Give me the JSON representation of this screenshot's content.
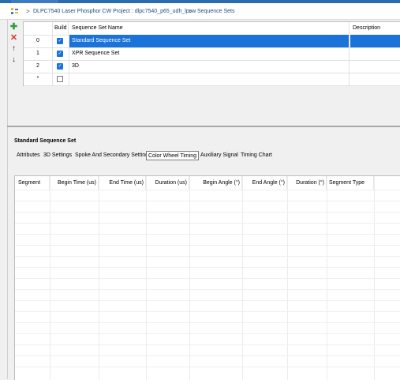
{
  "breadcrumb": {
    "project": "DLPC7540 Laser Phosphor CW Project : dlpc7540_p65_udh_lpcw",
    "section": "Sequence Sets",
    "sep": ">"
  },
  "toolbar": {
    "add_glyph": "✚",
    "remove_glyph": "✕",
    "up_glyph": "↑",
    "down_glyph": "↓"
  },
  "sets_grid": {
    "headers": {
      "build": "Build",
      "name": "Sequence Set Name",
      "description": "Description"
    },
    "rows": [
      {
        "index": "0",
        "build": true,
        "name": "Standard Sequence Set",
        "description": ""
      },
      {
        "index": "1",
        "build": true,
        "name": "XPR Sequence Set",
        "description": ""
      },
      {
        "index": "2",
        "build": true,
        "name": "3D",
        "description": ""
      }
    ],
    "new_row_marker": "*"
  },
  "detail": {
    "title": "Standard Sequence Set",
    "tabs": [
      {
        "label": "Attributes"
      },
      {
        "label": "3D Settings"
      },
      {
        "label": "Spoke And Secondary Settings"
      },
      {
        "label": "Color Wheel Timing"
      },
      {
        "label": "Auxiliary Signal"
      },
      {
        "label": "Timing Chart"
      }
    ],
    "active_tab": "Color Wheel Timing",
    "timing_headers": [
      "Segment",
      "Begin Time (us)",
      "End Time (us)",
      "Duration (us)",
      "Begin Angle  (°)",
      "End Angle  (°)",
      "Duration (°)",
      "Segment Type"
    ]
  },
  "colors": {
    "selection": "#1a73d9",
    "add_icon": "#2e9e3a",
    "remove_icon": "#d8342c",
    "breadcrumb_text": "#1a4f7a"
  }
}
